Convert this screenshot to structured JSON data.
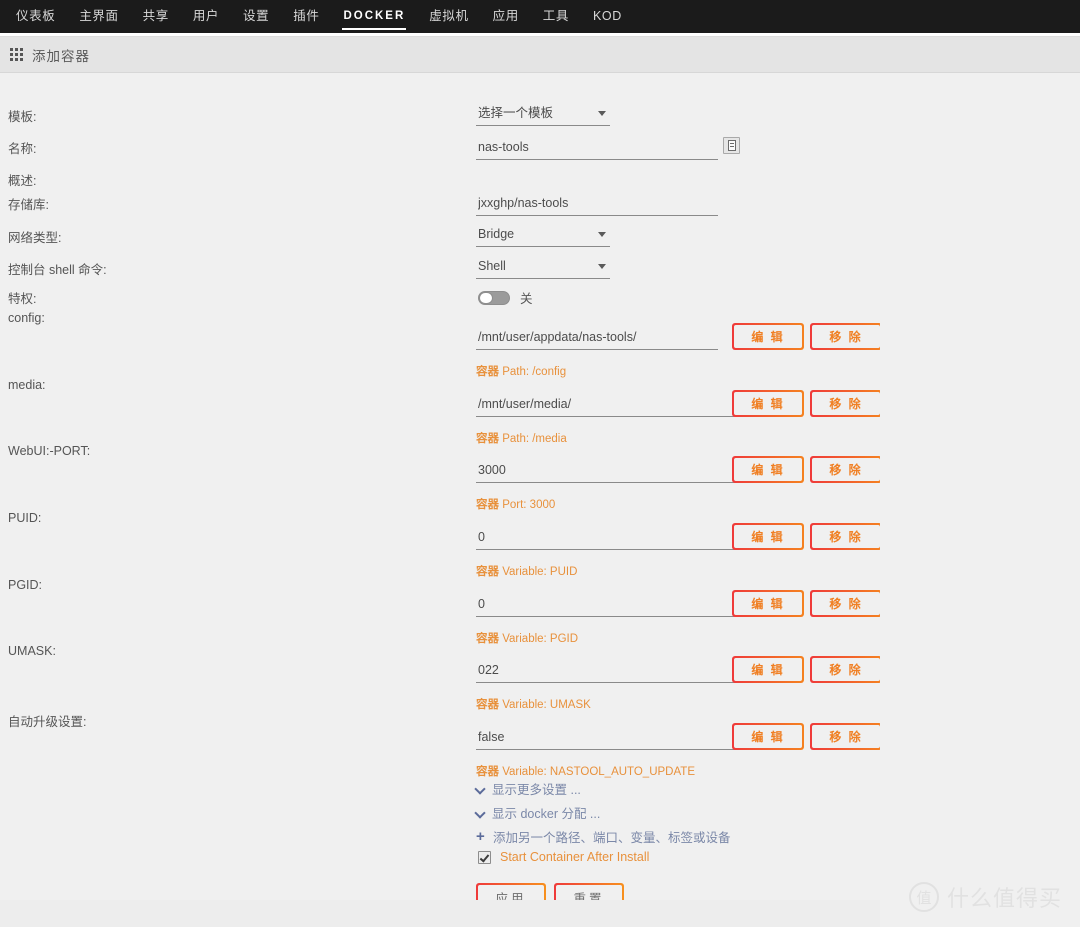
{
  "nav": {
    "items": [
      {
        "label": "仪表板",
        "active": false
      },
      {
        "label": "主界面",
        "active": false
      },
      {
        "label": "共享",
        "active": false
      },
      {
        "label": "用户",
        "active": false
      },
      {
        "label": "设置",
        "active": false
      },
      {
        "label": "插件",
        "active": false
      },
      {
        "label": "DOCKER",
        "active": true
      },
      {
        "label": "虚拟机",
        "active": false
      },
      {
        "label": "应用",
        "active": false
      },
      {
        "label": "工具",
        "active": false
      },
      {
        "label": "KOD",
        "active": false
      }
    ]
  },
  "header": {
    "title": "添加容器",
    "icon": "grid-icon"
  },
  "form": {
    "template": {
      "label": "模板:",
      "value": "选择一个模板"
    },
    "name": {
      "label": "名称:",
      "value": "nas-tools",
      "button_icon": "document-icon"
    },
    "overview": {
      "label": "概述:",
      "value": ""
    },
    "repository": {
      "label": "存储库:",
      "value": "jxxghp/nas-tools"
    },
    "network_type": {
      "label": "网络类型:",
      "value": "Bridge"
    },
    "console_shell": {
      "label": "控制台 shell 命令:",
      "value": "Shell"
    },
    "privileged": {
      "label": "特权:",
      "toggle_state": "off",
      "toggle_label": "关"
    },
    "mappings": [
      {
        "label": "config:",
        "value": "/mnt/user/appdata/nas-tools/",
        "hint_prefix": "容器",
        "hint_suffix": " Path: /config",
        "edit_label": "编 辑",
        "remove_label": "移 除"
      },
      {
        "label": "media:",
        "value": "/mnt/user/media/",
        "hint_prefix": "容器",
        "hint_suffix": " Path: /media",
        "edit_label": "编 辑",
        "remove_label": "移 除"
      },
      {
        "label": "WebUI:-PORT:",
        "value": "3000",
        "hint_prefix": "容器",
        "hint_suffix": " Port: 3000",
        "edit_label": "编 辑",
        "remove_label": "移 除"
      },
      {
        "label": "PUID:",
        "value": "0",
        "hint_prefix": "容器",
        "hint_suffix": " Variable: PUID",
        "edit_label": "编 辑",
        "remove_label": "移 除"
      },
      {
        "label": "PGID:",
        "value": "0",
        "hint_prefix": "容器",
        "hint_suffix": " Variable: PGID",
        "edit_label": "编 辑",
        "remove_label": "移 除"
      },
      {
        "label": "UMASK:",
        "value": "022",
        "hint_prefix": "容器",
        "hint_suffix": " Variable: UMASK",
        "edit_label": "编 辑",
        "remove_label": "移 除"
      },
      {
        "label": "自动升级设置:",
        "value": "false",
        "hint_prefix": "容器",
        "hint_suffix": " Variable: NASTOOL_AUTO_UPDATE",
        "edit_label": "编 辑",
        "remove_label": "移 除"
      }
    ],
    "links": [
      {
        "icon": "chevron-down-icon",
        "label": "显示更多设置 ..."
      },
      {
        "icon": "chevron-down-icon",
        "label": "显示 docker 分配 ..."
      },
      {
        "icon": "plus-icon",
        "label": "添加另一个路径、端口、变量、标签或设备"
      }
    ],
    "start_checkbox": {
      "label": "Start Container After Install",
      "checked": true
    },
    "actions": {
      "apply": "应用",
      "reset": "重置"
    }
  },
  "watermark": {
    "badge": "值",
    "text": "什么值得买"
  },
  "colors": {
    "accent_orange": "#f08025",
    "accent_red": "#ef3a3a",
    "hint": "#e8913c",
    "link": "#7b88a8",
    "nav_bg": "#1b1b1b"
  }
}
